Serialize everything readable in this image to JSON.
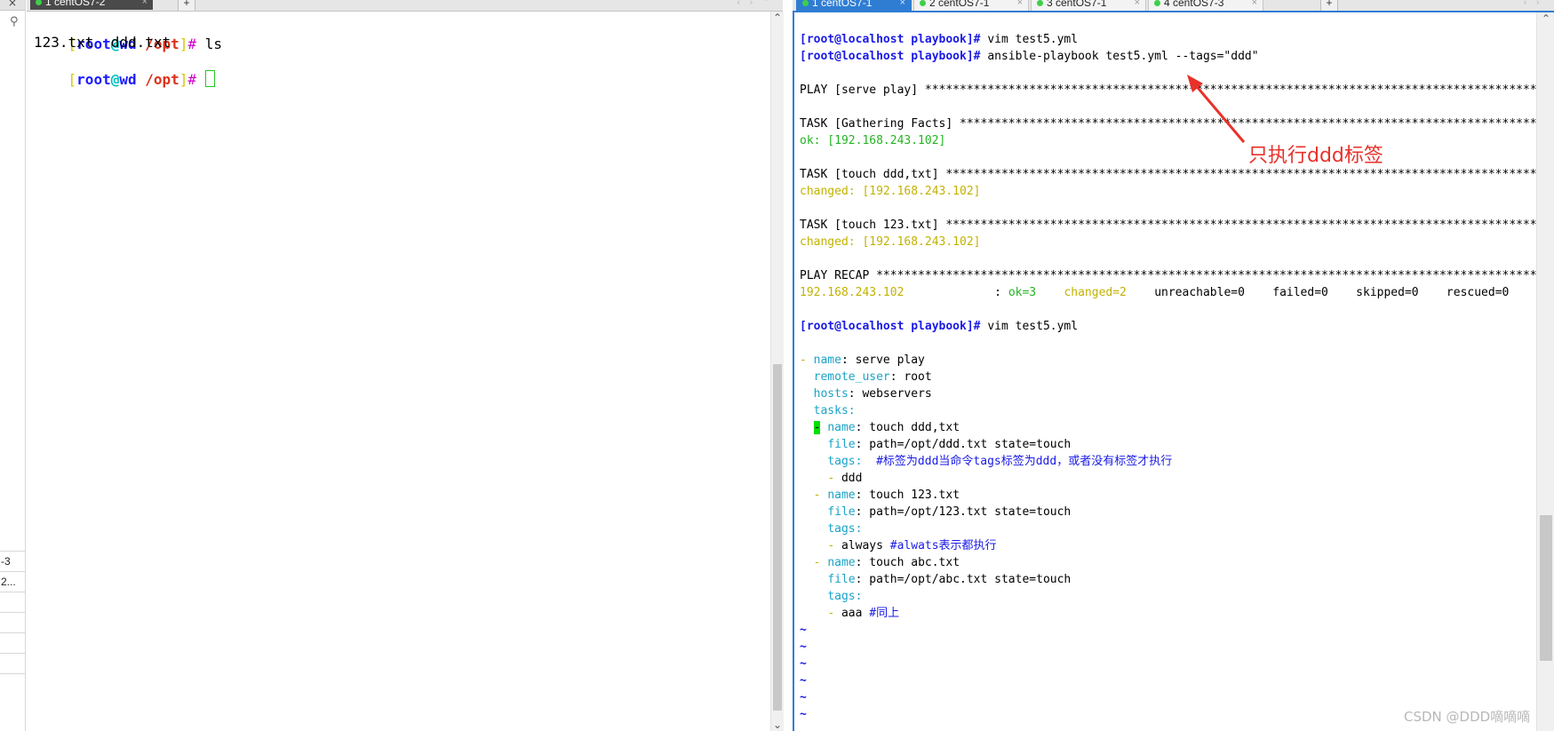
{
  "left_sliver": {
    "close_glyph": "×",
    "search_glyph": "⚲",
    "items": [
      "-3",
      "2...",
      "",
      "",
      "",
      "",
      ""
    ]
  },
  "left_terminal": {
    "tab": {
      "label": "1 centOS7-2",
      "close_glyph": "×"
    },
    "plus_label": "+",
    "nav_glyphs": "‹›⌃",
    "lines": [
      {
        "prompt": {
          "open": "[",
          "user": "root",
          "at": "@",
          "host": "wd",
          "path": " /opt",
          "close": "]",
          "hash": "#"
        },
        "cmd": " ls"
      },
      {
        "text": "123.txt  ddd.txt"
      },
      {
        "prompt": {
          "open": "[",
          "user": "root",
          "at": "@",
          "host": "wd",
          "path": " /opt",
          "close": "]",
          "hash": "#"
        },
        "cmd": " "
      }
    ]
  },
  "right_terminal": {
    "tabs": [
      {
        "label": "1 centOS7-1",
        "active": true
      },
      {
        "label": "2 centOS7-1",
        "active": false
      },
      {
        "label": "3 centOS7-1",
        "active": false
      },
      {
        "label": "4 centOS7-3",
        "active": false
      }
    ],
    "tab_close_glyph": "×",
    "plus_label": "+",
    "nav_glyphs": "‹›",
    "prompt": "[root@localhost playbook]#",
    "cmd1": " vim test5.yml",
    "cmd2": " ansible-playbook test5.yml --tags=\"ddd\"",
    "play_line": "PLAY [serve play] ************************************************************************************************",
    "task1_line": "TASK [Gathering Facts] *******************************************************************************************",
    "task1_result": "ok: [192.168.243.102]",
    "task2_line": "TASK [touch ddd,txt] *********************************************************************************************",
    "task2_result": "changed: [192.168.243.102]",
    "task3_line": "TASK [touch 123.txt] *********************************************************************************************",
    "task3_result": "changed: [192.168.243.102]",
    "recap_line": "PLAY RECAP *******************************************************************************************************",
    "recap": {
      "host": "192.168.243.102",
      "colon": "             : ",
      "ok": "ok=3",
      "changed": "changed=2",
      "rest": "    unreachable=0    failed=0    skipped=0    rescued=0"
    },
    "cmd3": " vim test5.yml",
    "yaml": {
      "dash": "- ",
      "name_key": "name",
      "name_val": ": serve play",
      "remote_user_key": "remote_user",
      "remote_user_val": ": root",
      "hosts_key": "hosts",
      "hosts_val": ": webservers",
      "tasks_key": "tasks",
      "tasks_colon": ":",
      "t1_dash": "-",
      "t1_name_val": ": touch ddd,txt",
      "t1_file_key": "file",
      "t1_file_val": ": path=/opt/ddd.txt state=touch",
      "t1_tags_key": "tags",
      "t1_tags_colon": ":",
      "t1_tags_comment": "  #标签为ddd当命令tags标签为ddd，或者没有标签才执行",
      "t1_tag_item": " ddd",
      "t2_name_val": ": touch 123.txt",
      "t2_file_val": ": path=/opt/123.txt state=touch",
      "t2_tag_item": " always ",
      "t2_tag_comment": "#alwats表示都执行",
      "t3_name_val": ": touch abc.txt",
      "t3_file_val": ": path=/opt/abc.txt state=touch",
      "t3_tag_item": " aaa ",
      "t3_tag_comment": "#同上",
      "tilde": "~"
    }
  },
  "annotation": {
    "text": "只执行ddd标签",
    "color": "#e8312a"
  },
  "watermark": "CSDN @DDD嘀嘀嘀",
  "colors": {
    "prompt_blue": "#1a1ae6",
    "ok_green": "#22b422",
    "changed_yellow": "#c2b200",
    "yaml_key_cyan": "#1aa3c7",
    "tab_active_blue": "#2f7dd3"
  }
}
